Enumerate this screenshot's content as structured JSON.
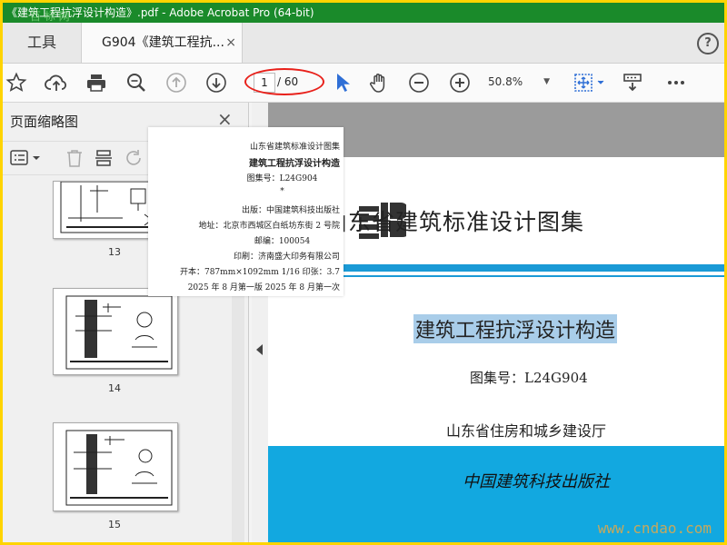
{
  "window": {
    "title": "《建筑工程抗浮设计构造》.pdf - Adobe Acrobat Pro (64-bit)",
    "watermark_top": "百 标 网"
  },
  "tabs": {
    "tools_label": "工具",
    "document_label": "G904《建筑工程抗...",
    "close": "×",
    "help": "?"
  },
  "toolbar": {
    "page_current": "1",
    "page_total": "/ 60",
    "zoom": "50.8%",
    "icons": [
      "bookmark-star-icon",
      "cloud-upload-icon",
      "print-icon",
      "zoom-search-icon",
      "prev-page-icon",
      "next-page-icon",
      "select-cursor-icon",
      "hand-tool-icon",
      "zoom-out-icon",
      "zoom-in-icon",
      "fit-page-icon",
      "stamp-tool-icon",
      "more-icon"
    ]
  },
  "sidebar": {
    "title": "页面缩略图",
    "close": "×",
    "thumbnails": [
      {
        "num": "13"
      },
      {
        "num": "14"
      },
      {
        "num": "15"
      }
    ]
  },
  "popup": {
    "series": "山东省建筑标准设计图集",
    "title": "建筑工程抗浮设计构造",
    "atlas": "图集号：L24G904",
    "star": "*",
    "publisher": "出版：中国建筑科技出版社",
    "address": "地址：北京市西城区白纸坊东街 2 号院",
    "postcode": "邮编：100054",
    "printer": "印刷：济南盛大印务有限公司",
    "format": "开本：787mm×1092mm  1/16    印张：3.7",
    "edition": "2025 年 8 月第一版    2025 年 8 月第一次"
  },
  "document": {
    "publisher_heading": "山东省建筑标准设计图集",
    "logo_text": "LB",
    "title": "建筑工程抗浮设计构造",
    "atlas_number": "图集号：L24G904",
    "department": "山东省住房和城乡建设厅",
    "press": "中国建筑科技出版社",
    "watermark": "www.cndao.com"
  },
  "colors": {
    "titlebar": "#1a8a2a",
    "frame": "#ffd400",
    "blue": "#1a9ad6",
    "highlight": "#a9cde9",
    "annotation": "#e8201a"
  }
}
